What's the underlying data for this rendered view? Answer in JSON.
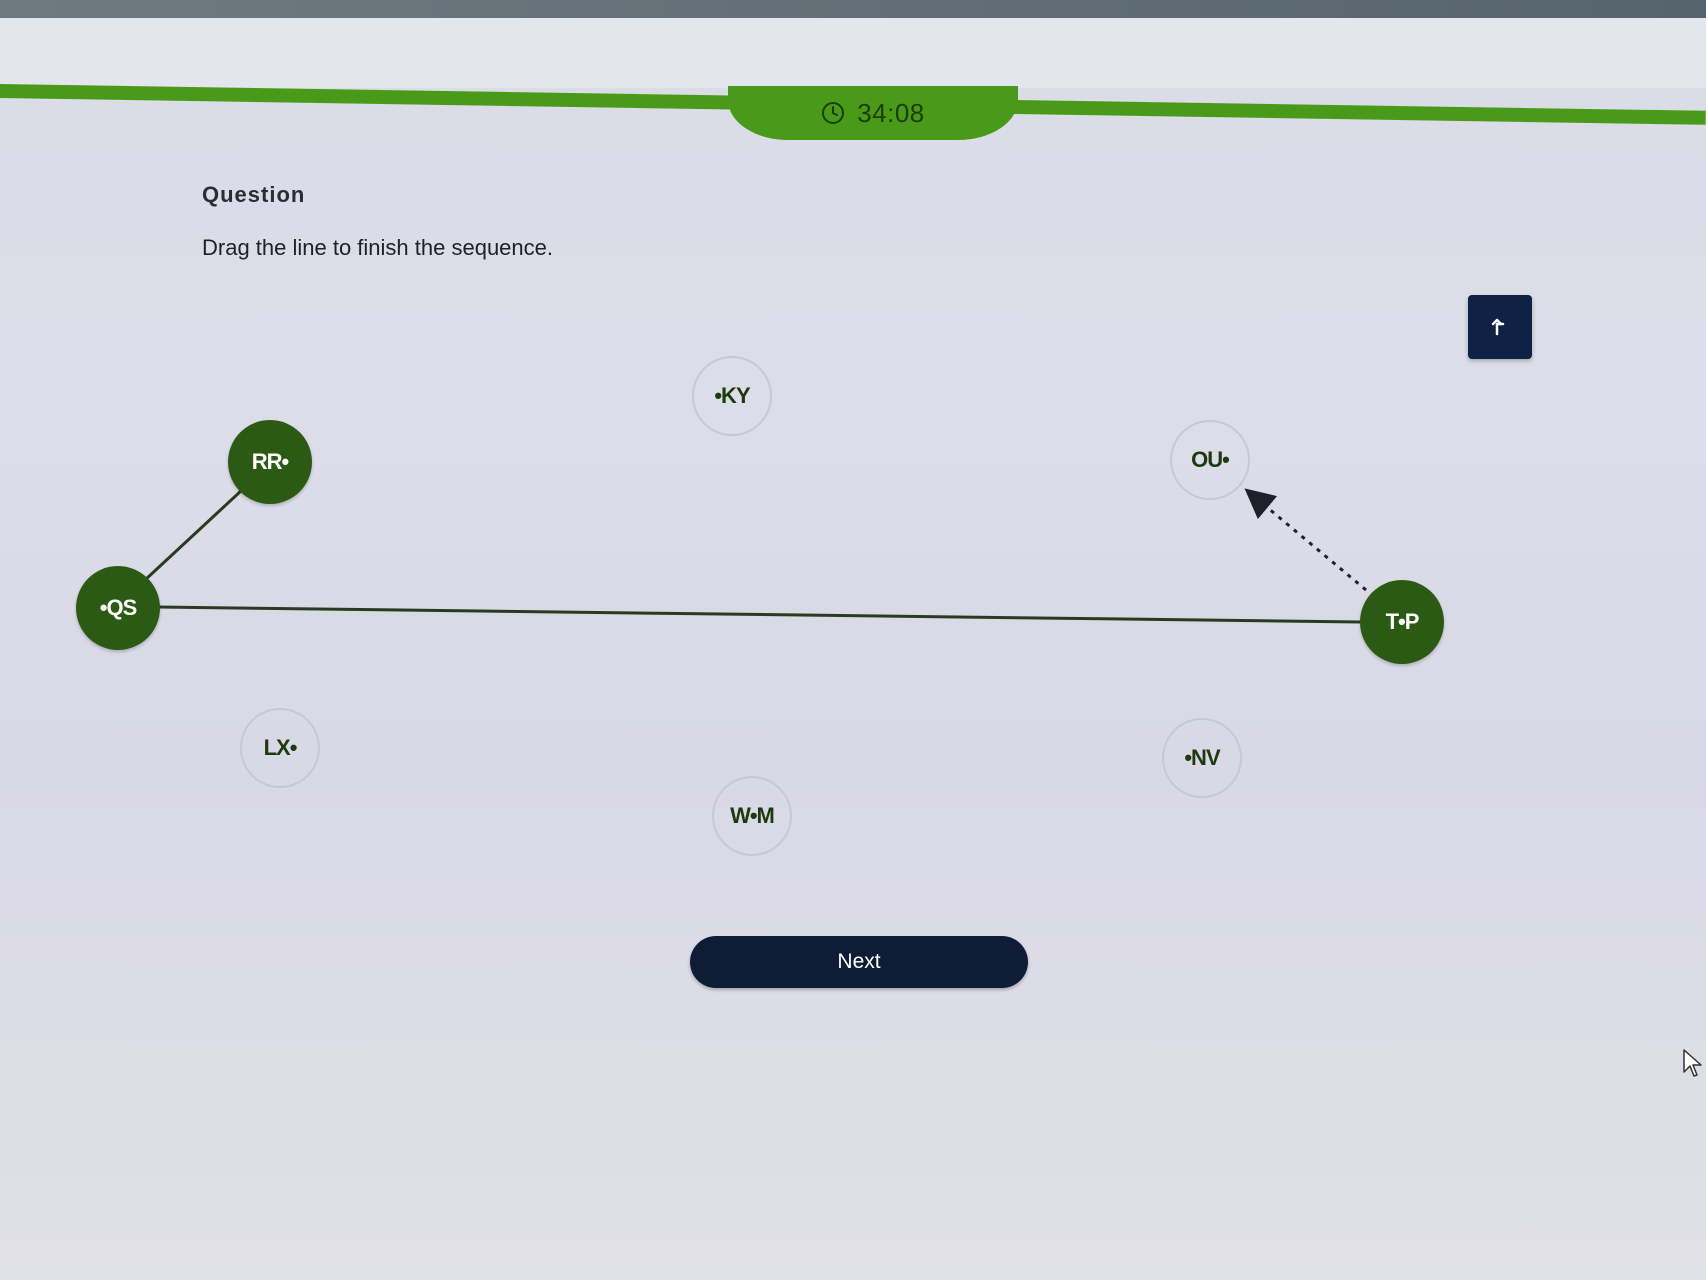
{
  "timer": {
    "text": "34:08",
    "icon": "clock-icon"
  },
  "question": {
    "label": "Question",
    "prompt": "Drag the line to finish the sequence."
  },
  "toolbar": {
    "undo_icon": "undo-arrow-icon"
  },
  "nodes": {
    "qs": {
      "label": "•QS",
      "state": "connected"
    },
    "rr": {
      "label": "RR•",
      "state": "connected"
    },
    "ky": {
      "label": "•KY",
      "state": "unconnected"
    },
    "ou": {
      "label": "OU•",
      "state": "unconnected"
    },
    "tp": {
      "label": "T•P",
      "state": "connected"
    },
    "lx": {
      "label": "LX•",
      "state": "unconnected"
    },
    "wm": {
      "label": "W•M",
      "state": "unconnected"
    },
    "nv": {
      "label": "•NV",
      "state": "unconnected"
    }
  },
  "connections": [
    {
      "from": "•QS",
      "to": "RR•",
      "style": "solid"
    },
    {
      "from": "•QS",
      "to": "T•P",
      "style": "solid"
    },
    {
      "from": "T•P",
      "to": "OU•",
      "style": "dotted-arrow"
    }
  ],
  "footer": {
    "next_label": "Next"
  },
  "colors": {
    "accent_green": "#4a9a1a",
    "node_active": "#2b5a14",
    "button_navy": "#0e1c36"
  }
}
